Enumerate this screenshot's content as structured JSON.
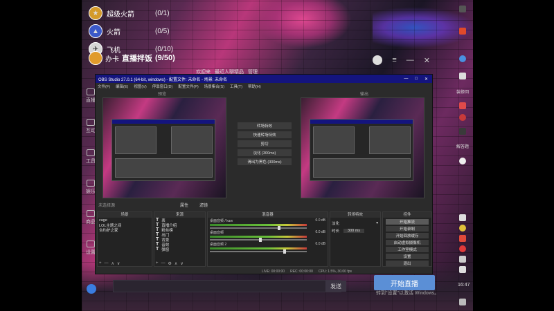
{
  "rooms": [
    {
      "name": "超级火箭",
      "count": "(0/1)",
      "color": "#d49a2a"
    },
    {
      "name": "火箭",
      "count": "(0/5)",
      "color": "#3b59c9"
    },
    {
      "name": "飞机",
      "count": "(0/10)",
      "color": "#d6d6d6"
    }
  ],
  "status": {
    "user": "办卡",
    "live_title": "直播拌饭",
    "live_count": "(9/50)"
  },
  "app": {
    "menu": [
      "欢迎来",
      "最近人聊精品",
      "管理"
    ],
    "sidebar": [
      "直播",
      "互动",
      "工具",
      "娱乐",
      "商品",
      "设置"
    ],
    "send_label": "发送",
    "start_live_label": "开始直播",
    "activate_windows": "转到\"设置\"以激活 Windows。"
  },
  "obs": {
    "title": "OBS Studio 27.0.1 (64-bit, windows) - 配置文件: 未命名 - 场景: 未命名",
    "menu": [
      "文件(F)",
      "编辑(E)",
      "视图(V)",
      "停靠窗口(D)",
      "配置文件(P)",
      "场景集合(S)",
      "工具(T)",
      "帮助(H)"
    ],
    "preview_label": "预览",
    "program_label": "输出",
    "transition": {
      "studio_button": "转场特效",
      "quick_label": "快速转场特效",
      "cut": "剪切",
      "fade": "淡化 (300ms)",
      "swipe": "滑出为黑色 (300ms)"
    },
    "scene_label": "未选择源",
    "preview_tabs": [
      "属性",
      "滤镜"
    ],
    "docks": {
      "scenes": {
        "title": "场景",
        "items": [
          "cage",
          "LOL主题之间",
          "合约护之家"
        ]
      },
      "sources": {
        "title": "来源",
        "items": [
          "表",
          "直播介绍",
          "粉丝榜",
          "出门",
          "背景",
          "音效",
          "弹窗"
        ]
      },
      "mixer": {
        "title": "混音器",
        "tracks": [
          {
            "name": "桌面音频 / kaw",
            "db": "0.0 dB",
            "level": 0.72
          },
          {
            "name": "桌面音频",
            "db": "0.0 dB",
            "level": 0.52
          },
          {
            "name": "桌面音频 2",
            "db": "0.0 dB",
            "level": 0.78
          }
        ]
      },
      "transitions": {
        "title": "转场特效",
        "type": "淡化",
        "duration_label": "时长",
        "duration": "300 ms"
      },
      "controls": {
        "title": "控件",
        "buttons": [
          "开始推流",
          "开始录制",
          "开始回放缓存",
          "启动虚拟摄像机",
          "工作室模式",
          "设置",
          "退出"
        ]
      }
    },
    "status": {
      "live": "LIVE: 00:00:00",
      "rec": "REC: 00:00:00",
      "cpu": "CPU: 1.5%, 30.00 fps"
    }
  },
  "tray": {
    "time": "16:47",
    "label1": "装修回",
    "label2": "解答题"
  }
}
